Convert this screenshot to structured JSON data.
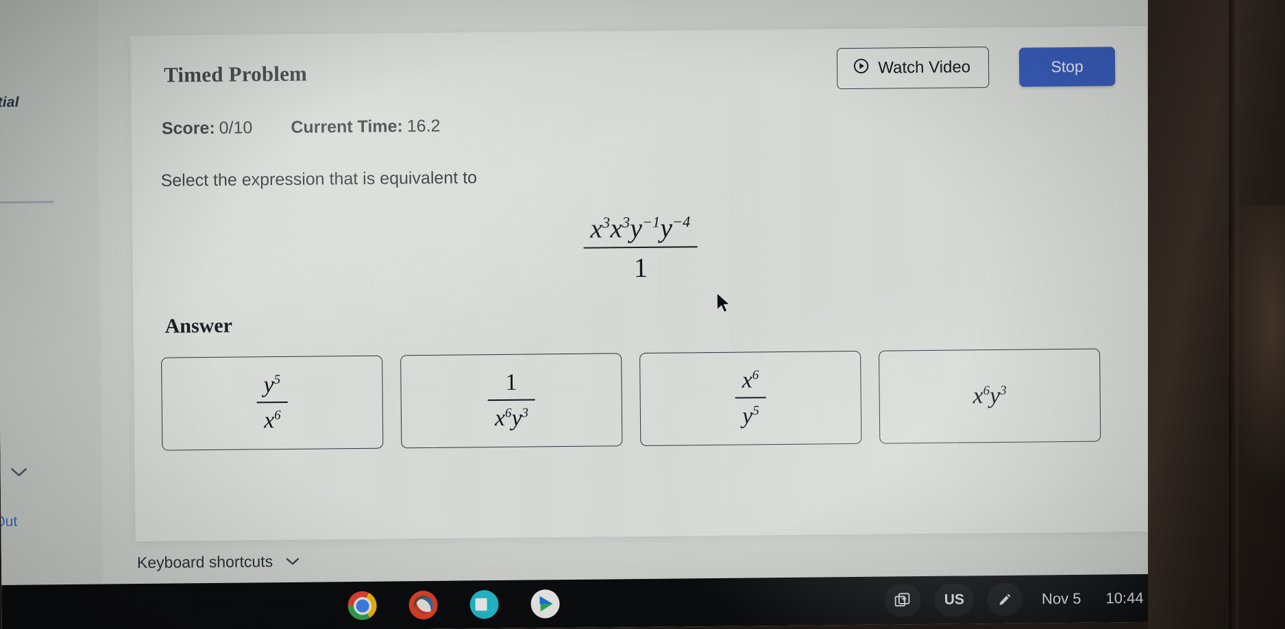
{
  "left_rail": {
    "title_partial": "ntial",
    "chevron_icon": "chevron-down-icon",
    "logout_partial": "Out"
  },
  "card": {
    "title": "Timed Problem",
    "watch_video_label": "Watch Video",
    "watch_video_icon": "play-circle-icon",
    "stop_label": "Stop",
    "stop_color": "#3a5fc0",
    "score_label": "Score:",
    "score_value": "0/10",
    "time_label": "Current Time:",
    "time_value": "16.2",
    "prompt": "Select the expression that is equivalent to",
    "answer_heading": "Answer"
  },
  "expression": {
    "numerator": [
      {
        "base": "x",
        "exp": "3"
      },
      {
        "base": "x",
        "exp": "3"
      },
      {
        "base": "y",
        "exp": "−1"
      },
      {
        "base": "y",
        "exp": "−4"
      }
    ],
    "denominator": "1"
  },
  "choices": [
    {
      "id": "choice-1",
      "kind": "fraction",
      "numerator": [
        {
          "base": "y",
          "exp": "5"
        }
      ],
      "denominator": [
        {
          "base": "x",
          "exp": "6"
        }
      ]
    },
    {
      "id": "choice-2",
      "kind": "fraction",
      "numerator": [
        {
          "base": "1",
          "exp": ""
        }
      ],
      "denominator": [
        {
          "base": "x",
          "exp": "6"
        },
        {
          "base": "y",
          "exp": "3"
        }
      ]
    },
    {
      "id": "choice-3",
      "kind": "fraction",
      "numerator": [
        {
          "base": "x",
          "exp": "6"
        }
      ],
      "denominator": [
        {
          "base": "y",
          "exp": "5"
        }
      ]
    },
    {
      "id": "choice-4",
      "kind": "plain",
      "terms": [
        {
          "base": "x",
          "exp": "6"
        },
        {
          "base": "y",
          "exp": "3"
        }
      ]
    }
  ],
  "footer": {
    "keyboard_shortcuts_label": "Keyboard shortcuts",
    "keyboard_shortcuts_icon": "chevron-down-icon"
  },
  "shelf": {
    "apps": [
      {
        "name": "chrome-app-icon",
        "class": "ic-chrome"
      },
      {
        "name": "paint-app-icon",
        "class": "ic-paint"
      },
      {
        "name": "slides-app-icon",
        "class": "ic-slides"
      },
      {
        "name": "play-store-app-icon",
        "class": "ic-play"
      }
    ],
    "desks_icon": "desks-icon",
    "keyboard_layout": "US",
    "stylus_icon": "stylus-icon",
    "date": "Nov 5",
    "time": "10:44",
    "wifi_icon": "wifi-icon",
    "battery_icon": "battery-icon"
  }
}
